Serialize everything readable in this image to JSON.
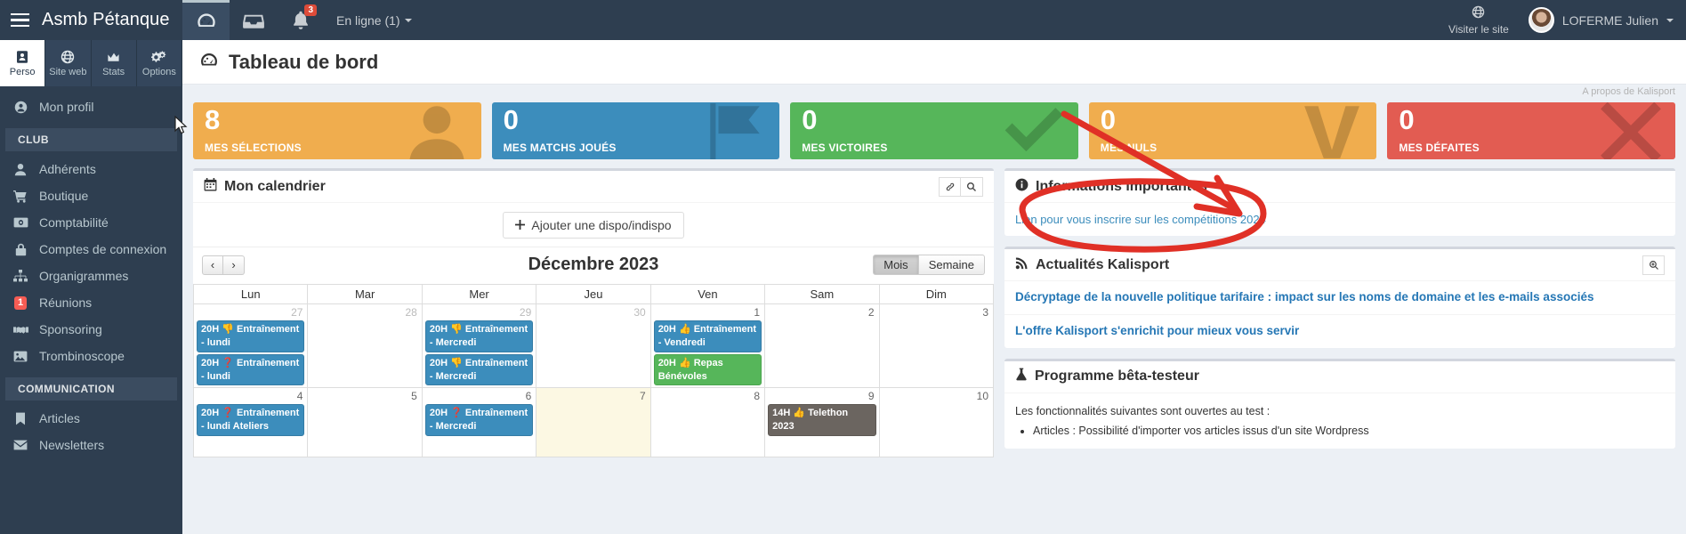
{
  "topbar": {
    "brand": "Asmb Pétanque",
    "menu_icon": "hamburger-icon",
    "dashboard_icon": "speedometer-icon",
    "inbox_icon": "inbox-icon",
    "bell_icon": "bell-icon",
    "notification_count": "3",
    "online_label": "En ligne (1)",
    "visit_site_label": "Visiter le site",
    "globe_icon": "globe-icon",
    "user_name": "LOFERME Julien"
  },
  "sidebar": {
    "tabs": [
      {
        "label": "Perso",
        "icon": "contact-card-icon",
        "active": true
      },
      {
        "label": "Site web",
        "icon": "globe-icon",
        "active": false
      },
      {
        "label": "Stats",
        "icon": "chart-area-icon",
        "active": false
      },
      {
        "label": "Options",
        "icon": "gears-icon",
        "active": false
      }
    ],
    "profile": {
      "label": "Mon profil",
      "icon": "user-circle-icon"
    },
    "section_club": "CLUB",
    "club_items": [
      {
        "label": "Adhérents",
        "icon": "user-icon",
        "badge": ""
      },
      {
        "label": "Boutique",
        "icon": "shopping-cart-icon",
        "badge": ""
      },
      {
        "label": "Comptabilité",
        "icon": "money-bill-icon",
        "badge": ""
      },
      {
        "label": "Comptes de connexion",
        "icon": "lock-icon",
        "badge": ""
      },
      {
        "label": "Organigrammes",
        "icon": "sitemap-icon",
        "badge": ""
      },
      {
        "label": "Réunions",
        "icon": "badge-number",
        "badge": "1"
      },
      {
        "label": "Sponsoring",
        "icon": "handshake-icon",
        "badge": ""
      },
      {
        "label": "Trombinoscope",
        "icon": "image-icon",
        "badge": ""
      }
    ],
    "section_communication": "COMMUNICATION",
    "communication_items": [
      {
        "label": "Articles",
        "icon": "bookmark-icon",
        "badge": ""
      },
      {
        "label": "Newsletters",
        "icon": "envelope-icon",
        "badge": ""
      }
    ]
  },
  "page": {
    "title": "Tableau de bord",
    "title_icon": "speedometer-icon",
    "about": "A propos de Kalisport"
  },
  "cards": [
    {
      "value": "8",
      "label": "MES SÉLECTIONS",
      "color": "#f0ad4e",
      "icon": "user-shape"
    },
    {
      "value": "0",
      "label": "MES MATCHS JOUÉS",
      "color": "#3c8dbc",
      "icon": "flag-shape"
    },
    {
      "value": "0",
      "label": "MES VICTOIRES",
      "color": "#56b65a",
      "icon": "check-shape"
    },
    {
      "value": "0",
      "label": "MES NULS",
      "color": "#f0ad4e",
      "icon": "equals-shape"
    },
    {
      "value": "0",
      "label": "MES DÉFAITES",
      "color": "#e25c52",
      "icon": "times-shape"
    }
  ],
  "calendar": {
    "panel_title": "Mon calendrier",
    "panel_icon": "calendar-icon",
    "tool_link_icon": "link-icon",
    "tool_search_icon": "search-icon",
    "add_button": "Ajouter une dispo/indispo",
    "prev_icon": "chevron-left-icon",
    "next_icon": "chevron-right-icon",
    "title": "Décembre 2023",
    "views": [
      {
        "label": "Mois",
        "active": true
      },
      {
        "label": "Semaine",
        "active": false
      }
    ],
    "day_headers": [
      "Lun",
      "Mar",
      "Mer",
      "Jeu",
      "Ven",
      "Sam",
      "Dim"
    ],
    "weeks": [
      [
        {
          "num": "27",
          "other": true,
          "today": false,
          "events": [
            {
              "time": "20H",
              "icon": "thumbs-down",
              "title": "Entraînement - lundi",
              "color": "blue"
            },
            {
              "time": "20H",
              "icon": "question",
              "title": "Entraînement - lundi",
              "color": "blue"
            }
          ]
        },
        {
          "num": "28",
          "other": true,
          "today": false,
          "events": []
        },
        {
          "num": "29",
          "other": true,
          "today": false,
          "events": [
            {
              "time": "20H",
              "icon": "thumbs-down",
              "title": "Entraînement - Mercredi",
              "color": "blue"
            },
            {
              "time": "20H",
              "icon": "thumbs-down",
              "title": "Entraînement - Mercredi",
              "color": "blue"
            }
          ]
        },
        {
          "num": "30",
          "other": true,
          "today": false,
          "events": []
        },
        {
          "num": "1",
          "other": false,
          "today": false,
          "events": [
            {
              "time": "20H",
              "icon": "thumbs-up",
              "title": "Entraînement - Vendredi",
              "color": "blue"
            },
            {
              "time": "20H",
              "icon": "thumbs-up",
              "title": "Repas Bénévoles",
              "color": "green"
            }
          ]
        },
        {
          "num": "2",
          "other": false,
          "today": false,
          "events": []
        },
        {
          "num": "3",
          "other": false,
          "today": false,
          "events": []
        }
      ],
      [
        {
          "num": "4",
          "other": false,
          "today": false,
          "events": [
            {
              "time": "20H",
              "icon": "question",
              "title": "Entraînement - lundi Ateliers",
              "color": "blue"
            }
          ]
        },
        {
          "num": "5",
          "other": false,
          "today": false,
          "events": []
        },
        {
          "num": "6",
          "other": false,
          "today": false,
          "events": [
            {
              "time": "20H",
              "icon": "question",
              "title": "Entraînement - Mercredi",
              "color": "blue"
            }
          ]
        },
        {
          "num": "7",
          "other": false,
          "today": true,
          "events": []
        },
        {
          "num": "8",
          "other": false,
          "today": false,
          "events": []
        },
        {
          "num": "9",
          "other": false,
          "today": false,
          "events": [
            {
              "time": "14H",
              "icon": "thumbs-up",
              "title": "Telethon 2023",
              "color": "gray"
            }
          ]
        },
        {
          "num": "10",
          "other": false,
          "today": false,
          "events": []
        }
      ]
    ]
  },
  "info_panel": {
    "title": "Informations importantes",
    "icon": "info-circle-icon",
    "link": "Lien pour vous inscrire sur les compétitions 2024"
  },
  "news_panel": {
    "title": "Actualités Kalisport",
    "icon": "rss-icon",
    "search_icon": "search-plus-icon",
    "items": [
      "Décryptage de la nouvelle politique tarifaire : impact sur les noms de domaine et les e-mails associés",
      "L'offre Kalisport s'enrichit pour mieux vous servir"
    ]
  },
  "beta_panel": {
    "title": "Programme bêta-testeur",
    "icon": "flask-icon",
    "intro": "Les fonctionnalités suivantes sont ouvertes au test :",
    "bullets": [
      "Articles : Possibilité d'importer vos articles issus d'un site Wordpress"
    ]
  },
  "annotation": {
    "color": "#e03026",
    "shapes": "red-arrow-and-ellipse-highlighting-info-link"
  }
}
